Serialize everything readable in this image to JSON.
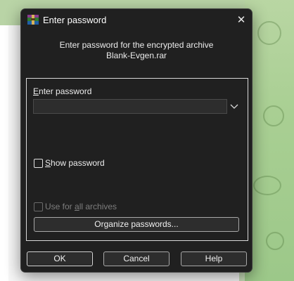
{
  "dialog": {
    "title": "Enter password",
    "prompt_line1": "Enter password for the encrypted archive",
    "prompt_line2": "Blank-Evgen.rar",
    "close_label": "✕"
  },
  "form": {
    "password_label": "Enter password",
    "password_value": "",
    "show_password_label": "Show password",
    "use_for_all_label": "Use for all archives",
    "organize_label": "Organize passwords..."
  },
  "buttons": {
    "ok": "OK",
    "cancel": "Cancel",
    "help": "Help"
  },
  "icons": {
    "app": "winrar-archive-icon",
    "close": "close-icon",
    "dropdown": "chevron-down-icon"
  },
  "colors": {
    "dialog_bg": "#202020",
    "border_light": "#d9d9d9",
    "text": "#ececec",
    "disabled_text": "#7d7d7d",
    "background_green": "#a9cf93"
  }
}
